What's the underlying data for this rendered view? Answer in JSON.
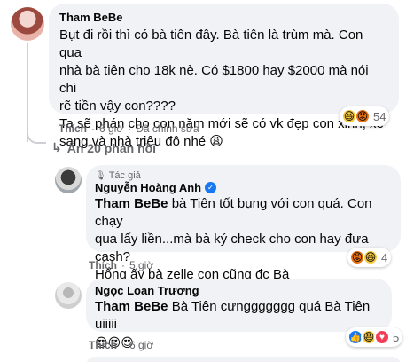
{
  "comments": [
    {
      "author": "Tham BeBe",
      "text": "Bụt đi rồi thì có bà tiên đây. Bà tiên là trùm mà. Con qua nhà bà tiên cho 18k nè. Có $1800 hay $2000 mà nói chi rẽ tiền vậy con????\nTa sẽ phán cho con năm mới sẽ có vk đẹp con xinh, xe sang và nhà triệu đô nhé 😩",
      "lines": [
        "Bụt đi rồi thì có bà tiên đây. Bà tiên là trùm mà. Con qua",
        "nhà bà tiên cho 18k nè. Có $1800 hay $2000 mà nói chi",
        "rẽ tiền vậy con????",
        "Ta sẽ phán cho con năm mới sẽ có vk đẹp con xinh, xe",
        "sang và nhà triệu đô nhé 😩"
      ],
      "like_label": "Thích",
      "time": "6 giờ",
      "edited_label": "Đã chỉnh sửa",
      "reaction_count": "54",
      "reactions": [
        "haha-icon",
        "angry-icon"
      ]
    }
  ],
  "show_replies": "Ẩn 20 phản hồi",
  "replies": [
    {
      "author_badge": "Tác giả",
      "author": "Nguyễn Hoàng Anh",
      "verified": true,
      "mention": "Tham BeBe",
      "lines": [
        " bà Tiên tốt bụng với con quá. Con chạy",
        "qua lấy liền...mà bà ký check cho con hay đưa cash?",
        "Hổng ấy bà zelle con cũng đc Bà"
      ],
      "like_label": "Thích",
      "time": "5 giờ",
      "reaction_count": "4",
      "reactions": [
        "angry-icon",
        "haha-icon"
      ]
    },
    {
      "author": "Ngọc Loan Trương",
      "mention": "Tham BeBe",
      "line": " Bà Tiên cưnggggggg quá Bà Tiên uiiiii",
      "emoji_line": "😍😍😍",
      "like_label": "Thích",
      "time": "6 giờ",
      "reaction_count": "5",
      "reactions": [
        "like-icon",
        "haha-icon",
        "love-icon"
      ]
    }
  ],
  "colors": {
    "bubble": "#f0f2f5",
    "secondary_text": "#65676b",
    "like_blue": "#1877f2",
    "verified_blue": "#1877f2"
  }
}
